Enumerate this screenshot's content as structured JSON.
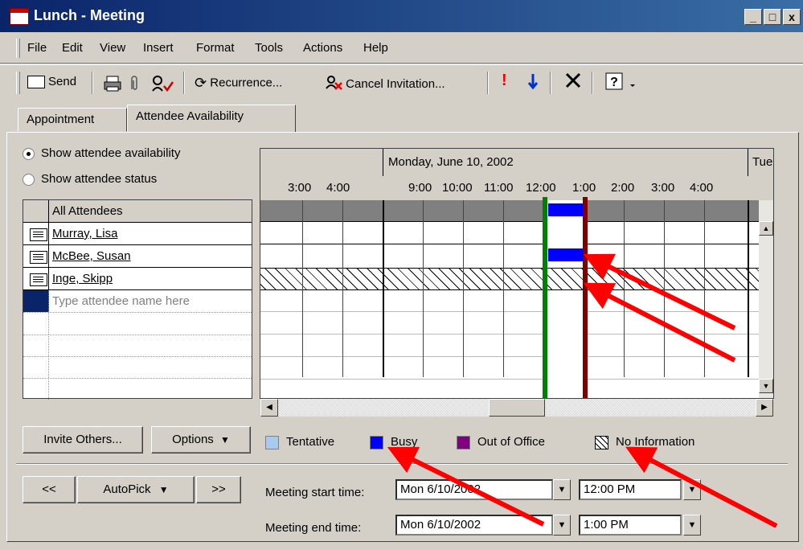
{
  "window": {
    "title": "Lunch - Meeting",
    "controls": [
      "_",
      "□",
      "x"
    ]
  },
  "menubar": [
    "File",
    "Edit",
    "View",
    "Insert",
    "Format",
    "Tools",
    "Actions",
    "Help"
  ],
  "toolbar": {
    "send": "Send",
    "recurrence": "Recurrence...",
    "cancel_invitation": "Cancel Invitation..."
  },
  "tabs": [
    "Appointment",
    "Attendee Availability"
  ],
  "options": {
    "show_availability": "Show attendee availability",
    "show_status": "Show attendee status"
  },
  "attendees": {
    "header": "All Attendees",
    "list": [
      "Murray, Lisa",
      "McBee, Susan",
      "Inge, Skipp"
    ],
    "placeholder": "Type attendee name here"
  },
  "schedule": {
    "date": "Monday, June 10, 2002",
    "next_day": "Tue",
    "hours_left": [
      "3:00",
      "4:00"
    ],
    "hours_main": [
      "9:00",
      "10:00",
      "11:00",
      "12:00",
      "1:00",
      "2:00",
      "3:00",
      "4:00"
    ]
  },
  "legend": {
    "tentative": "Tentative",
    "busy": "Busy",
    "out_of_office": "Out of Office",
    "no_information": "No Information"
  },
  "buttons": {
    "invite_others": "Invite Others...",
    "options": "Options",
    "prev": "<<",
    "autopick": "AutoPick",
    "next": ">>"
  },
  "meeting": {
    "start_label": "Meeting start time:",
    "start_date": "Mon 6/10/2002",
    "start_time": "12:00 PM",
    "end_label": "Meeting end time:",
    "end_date": "Mon 6/10/2002",
    "end_time": "1:00 PM"
  },
  "colors": {
    "tentative": "#a6caf0",
    "busy": "#0000ff",
    "out_of_office": "#800080",
    "start_marker": "#008000",
    "end_marker": "#800000",
    "annotation": "#ff0000"
  }
}
